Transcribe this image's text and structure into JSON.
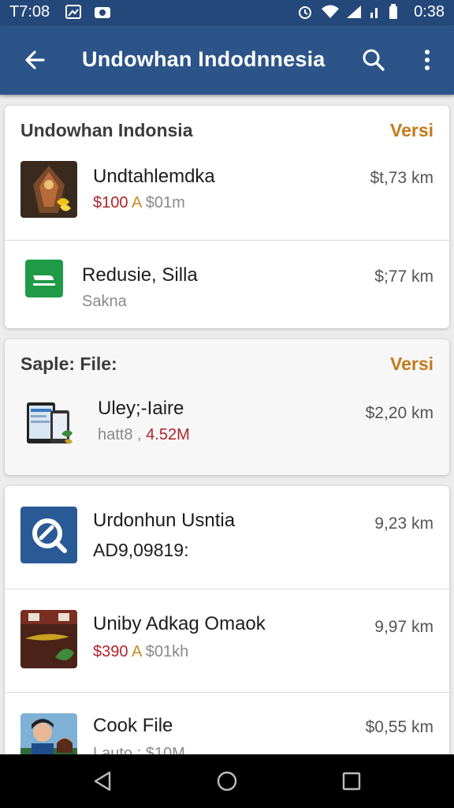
{
  "status_bar": {
    "time_left": "T7:08",
    "time_right": "0:38"
  },
  "app_bar": {
    "title": "Undowhan Indodnnesia"
  },
  "sections": [
    {
      "header": {
        "title": "Undowhan Indonsia",
        "link": "Versi"
      },
      "items": [
        {
          "name": "Undtahlemdka",
          "price": "$100",
          "alt": "A",
          "sub": " $01m",
          "distance": "$t,73 km",
          "thumb_icon": "artwork-thumbnail"
        },
        {
          "name": "Redusie, Silla",
          "sub": "Sakna",
          "distance": "$;77 km",
          "thumb_icon": "green-app-icon"
        }
      ]
    },
    {
      "header": {
        "title": "Saple: File:",
        "link": "Versi"
      },
      "items": [
        {
          "name": "Uley;-Iaire",
          "sub": "hatt8 ,",
          "price": "4.52M",
          "distance": "$2,20 km",
          "thumb_icon": "devices-icon"
        }
      ]
    },
    {
      "items": [
        {
          "name": "Urdonhun Usntia",
          "sub": "AD9,09819:",
          "distance": "9,23 km",
          "thumb_icon": "magnifier-app-icon"
        },
        {
          "name": "Uniby Adkag Omaok",
          "price": "$390",
          "alt": "A",
          "sub": " $01kh",
          "distance": "9,97 km",
          "thumb_icon": "food-thumbnail"
        },
        {
          "name": "Cook File",
          "sub": "Lauto ; $10M",
          "distance": "$0,55 km",
          "thumb_icon": "people-thumbnail"
        }
      ]
    }
  ]
}
